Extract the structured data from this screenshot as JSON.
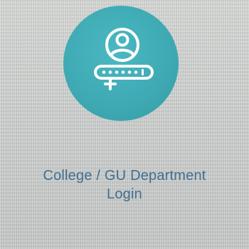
{
  "tile": {
    "icon": "user-login-icon",
    "label_line_1": "College / GU Department",
    "label_line_2": "Login"
  },
  "colors": {
    "circle": "#3ea9b3",
    "icon_stroke": "#ffffff",
    "label": "#3f6f93"
  }
}
